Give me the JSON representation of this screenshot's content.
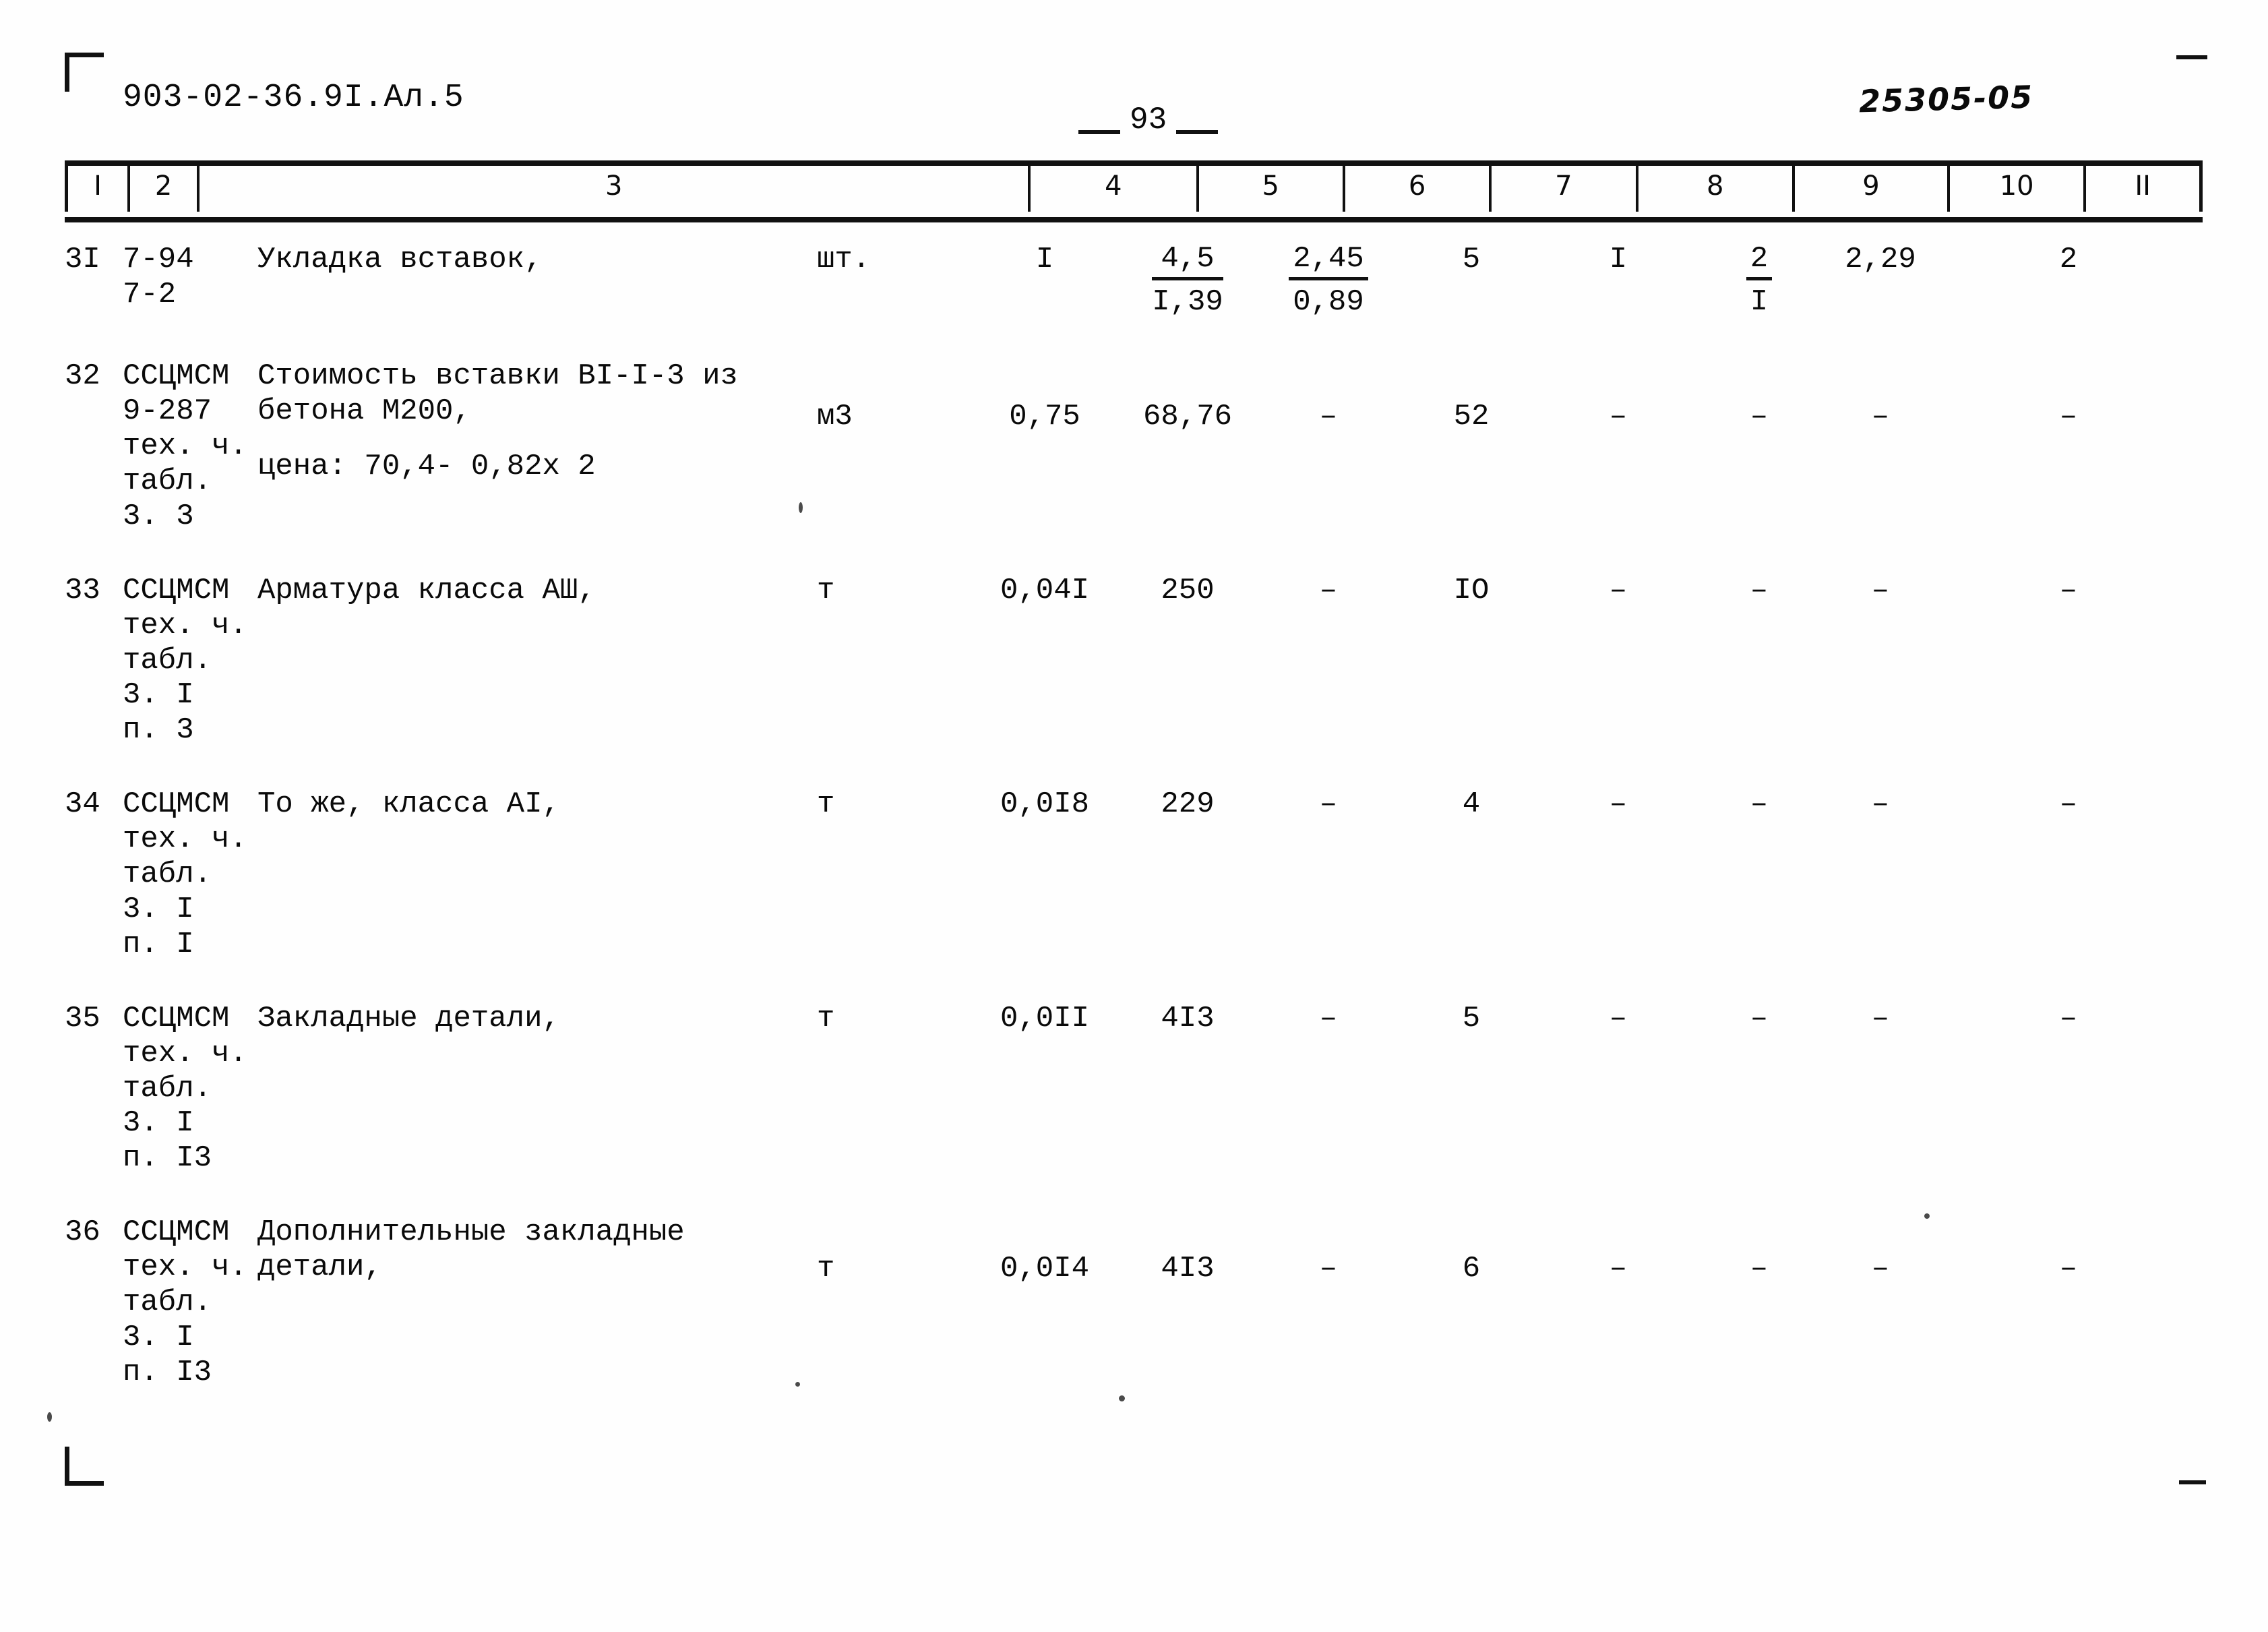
{
  "document": {
    "code": "903-02-36.9I.Ал.5",
    "stamp": "25305-05",
    "page_number": "93"
  },
  "table": {
    "column_headers": [
      "I",
      "2",
      "3",
      "4",
      "5",
      "6",
      "7",
      "8",
      "9",
      "10",
      "II"
    ],
    "rows": [
      {
        "num": "3I",
        "code": "7-94\n7-2",
        "desc": "Укладка вставок,",
        "desc_extra": "",
        "unit": "шт.",
        "c4": "I",
        "c5_top": "4,5",
        "c5_bot": "I,39",
        "c6_top": "2,45",
        "c6_bot": "0,89",
        "c7": "5",
        "c8": "I",
        "c9_top": "2",
        "c9_bot": "I",
        "c10": "2,29",
        "c11": "2"
      },
      {
        "num": "32",
        "code": "ССЦМСМ\n9-287\nтех. ч.\nтабл.\n3. 3",
        "desc": "Стоимость вставки ВI-I-3 из\nбетона М200,",
        "desc_extra": "цена: 70,4- 0,82х 2",
        "unit": "м3",
        "c4": "0,75",
        "c5": "68,76",
        "c6": "–",
        "c7": "52",
        "c8": "–",
        "c9": "–",
        "c10": "–",
        "c11": "–"
      },
      {
        "num": "33",
        "code": "ССЦМСМ\nтех. ч.\nтабл.\n3. I\nп. 3",
        "desc": "Арматура класса АШ,",
        "desc_extra": "",
        "unit": "т",
        "c4": "0,04I",
        "c5": "250",
        "c6": "–",
        "c7": "IO",
        "c8": "–",
        "c9": "–",
        "c10": "–",
        "c11": "–"
      },
      {
        "num": "34",
        "code": "ССЦМСМ\nтех. ч.\nтабл.\n3. I\nп. I",
        "desc": "То же, класса АI,",
        "desc_extra": "",
        "unit": "т",
        "c4": "0,0I8",
        "c5": "229",
        "c6": "–",
        "c7": "4",
        "c8": "–",
        "c9": "–",
        "c10": "–",
        "c11": "–"
      },
      {
        "num": "35",
        "code": "ССЦМСМ\nтех. ч.\nтабл.\n3. I\nп. I3",
        "desc": "Закладные детали,",
        "desc_extra": "",
        "unit": "т",
        "c4": "0,0II",
        "c5": "4I3",
        "c6": "–",
        "c7": "5",
        "c8": "–",
        "c9": "–",
        "c10": "–",
        "c11": "–"
      },
      {
        "num": "36",
        "code": "ССЦМСМ\nтех. ч.\nтабл.\n3. I\nп. I3",
        "desc": "Дополнительные закладные\nдетали,",
        "desc_extra": "",
        "unit": "т",
        "c4": "0,0I4",
        "c5": "4I3",
        "c6": "–",
        "c7": "6",
        "c8": "–",
        "c9": "–",
        "c10": "–",
        "c11": "–"
      }
    ]
  }
}
